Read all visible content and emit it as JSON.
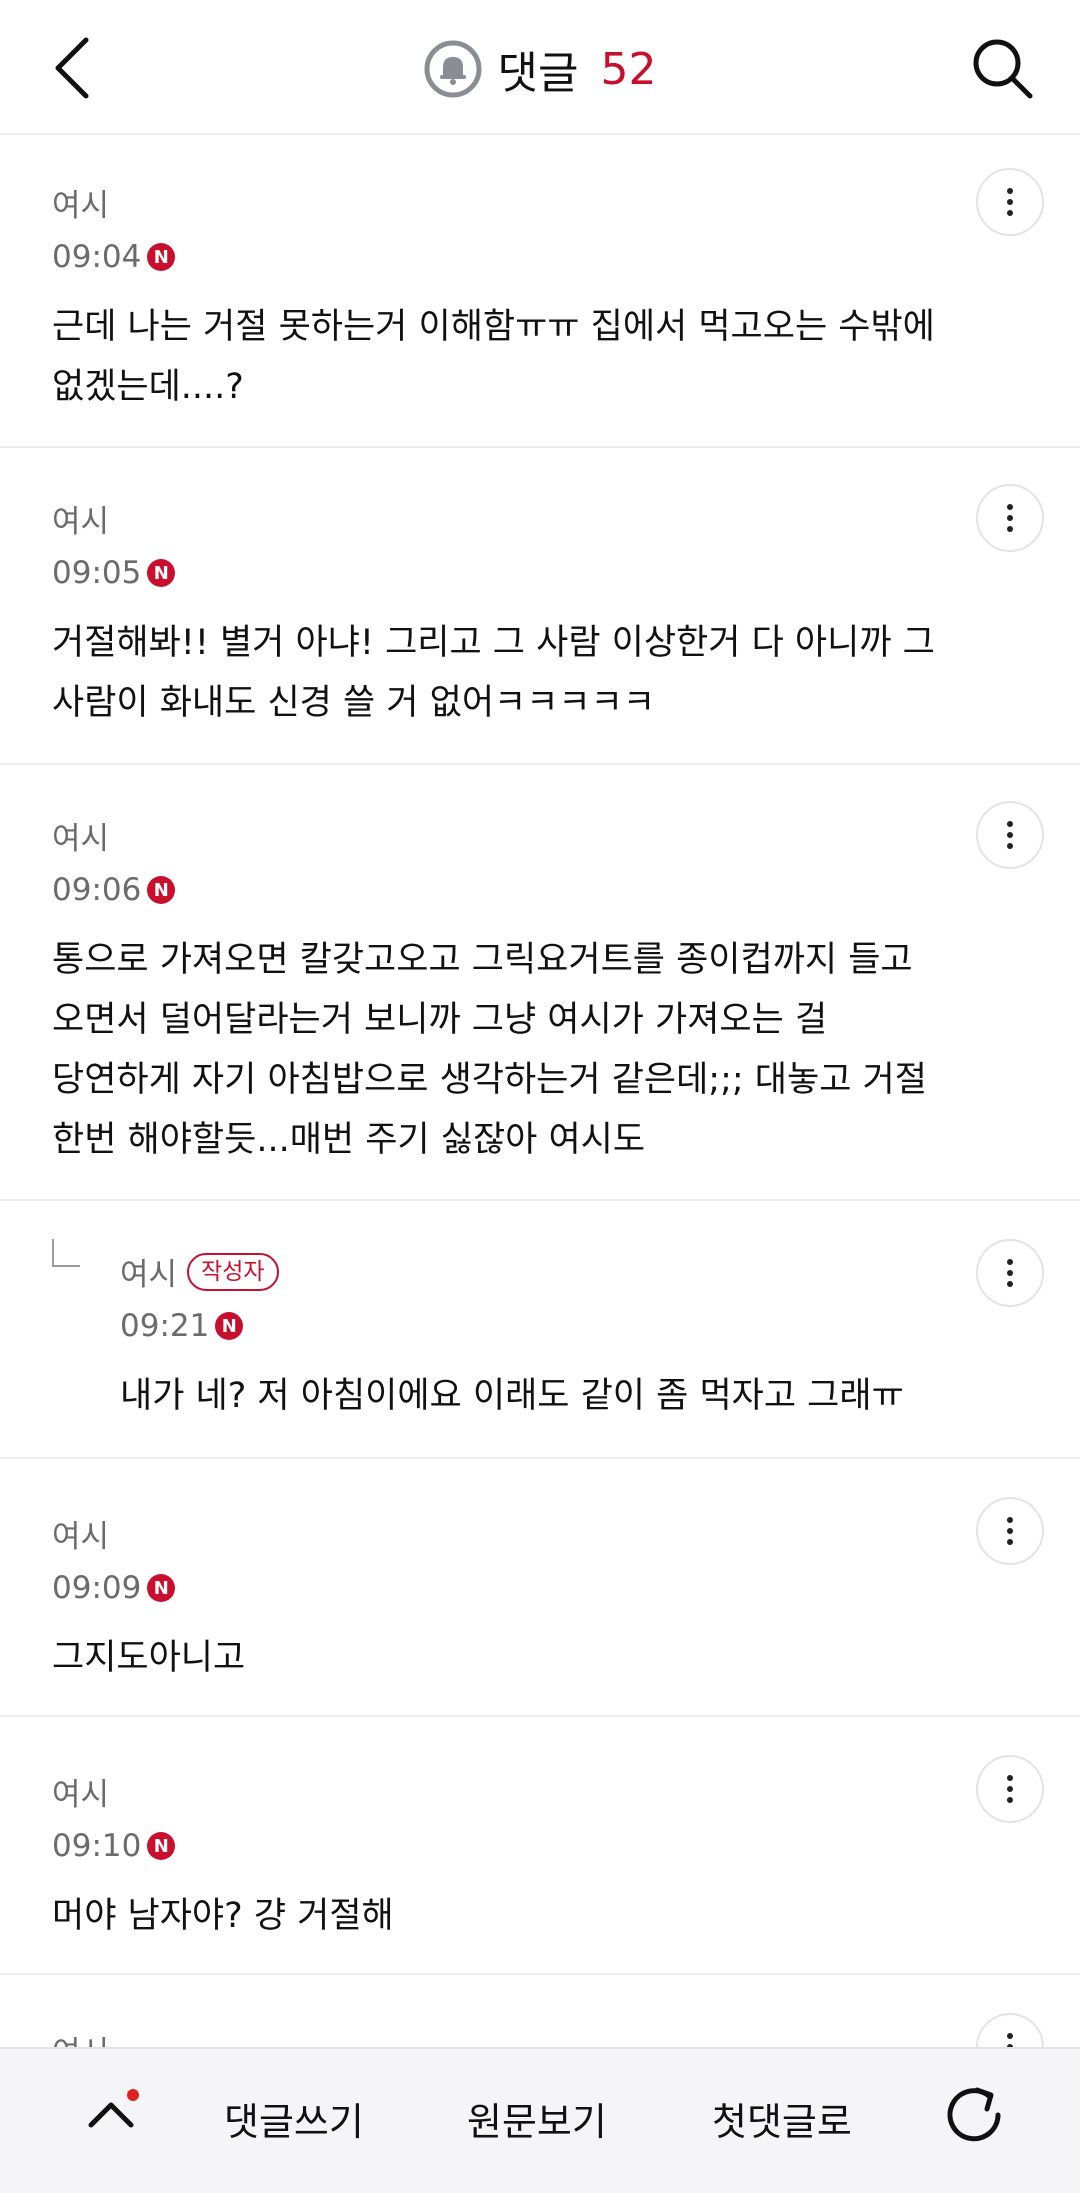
{
  "header": {
    "title": "댓글",
    "count": "52"
  },
  "comments": [
    {
      "author": "여시",
      "time": "09:04",
      "new_badge": "N",
      "text_lines": [
        "근데 나는 거절 못하는거 이해함ㅠㅠ 집에서 먹고오는 수밖에",
        "없겠는데....?"
      ]
    },
    {
      "author": "여시",
      "time": "09:05",
      "new_badge": "N",
      "text_lines": [
        "거절해봐!! 별거 아냐! 그리고 그 사람 이상한거 다 아니까 그",
        "사람이 화내도 신경 쓸 거 없어ㅋㅋㅋㅋㅋ"
      ]
    },
    {
      "author": "여시",
      "time": "09:06",
      "new_badge": "N",
      "text_lines": [
        "통으로 가져오면 칼갖고오고 그릭요거트를 종이컵까지 들고",
        "오면서 덜어달라는거 보니까 그냥 여시가 가져오는 걸",
        "당연하게 자기 아침밥으로 생각하는거 같은데;;; 대놓고 거절",
        "한번 해야할듯...매번 주기 싫잖아 여시도"
      ]
    },
    {
      "author": "여시",
      "author_badge": "작성자",
      "time": "09:21",
      "new_badge": "N",
      "text_lines": [
        "내가 네? 저 아침이에요 이래도 같이 좀 먹자고 그래ㅠ"
      ]
    },
    {
      "author": "여시",
      "time": "09:09",
      "new_badge": "N",
      "text_lines": [
        "그지도아니고"
      ]
    },
    {
      "author": "여시",
      "time": "09:10",
      "new_badge": "N",
      "text_lines": [
        "머야 남자야? 걍 거절해"
      ]
    },
    {
      "author": "여시"
    }
  ],
  "bottombar": {
    "write_label": "댓글쓰기",
    "original_label": "원문보기",
    "first_label": "첫댓글로"
  },
  "colors": {
    "accent": "#c8102e",
    "meta_text": "#6b6b6b",
    "divider": "#ececec",
    "bottombar_bg": "#f5f5f7"
  },
  "icons": {
    "back": "chevron-left-icon",
    "bell": "bell-icon",
    "search": "search-icon",
    "more": "more-vertical-icon",
    "up": "chevron-up-icon",
    "refresh": "refresh-icon"
  }
}
